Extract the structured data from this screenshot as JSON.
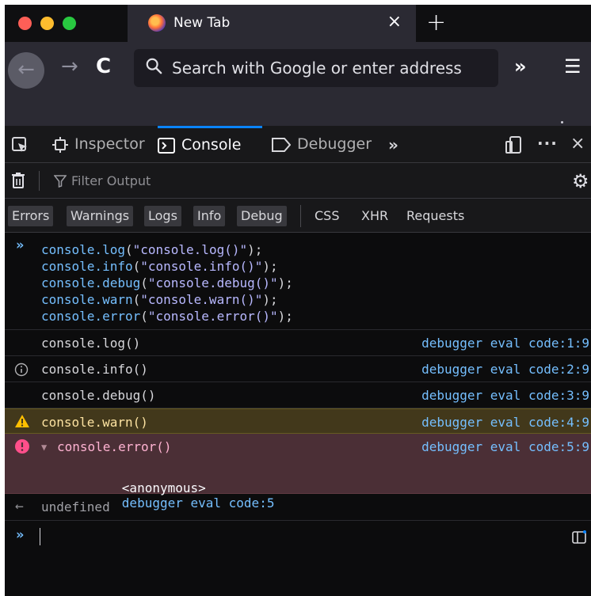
{
  "tab": {
    "title": "New Tab",
    "close_label": "×",
    "new_tab_label": "+"
  },
  "nav": {
    "back_label": "←",
    "forward_label": "→",
    "reload_label": "C",
    "url_placeholder": "Search with Google or enter address",
    "overflow_label": "»",
    "menu_label": "☰"
  },
  "devtools": {
    "tabs": [
      {
        "label": "Inspector"
      },
      {
        "label": "Console"
      },
      {
        "label": "Debugger"
      }
    ],
    "more_tabs_label": "»",
    "options_label": "···",
    "close_label": "×",
    "selected_tab": "Console"
  },
  "filter": {
    "placeholder": "Filter Output"
  },
  "categories": {
    "levels": [
      "Errors",
      "Warnings",
      "Logs",
      "Info",
      "Debug"
    ],
    "types": [
      "CSS",
      "XHR",
      "Requests"
    ]
  },
  "console": {
    "input_block": {
      "lines": [
        {
          "fn": "console.log",
          "arg": "\"console.log()\""
        },
        {
          "fn": "console.info",
          "arg": "\"console.info()\""
        },
        {
          "fn": "console.debug",
          "arg": "\"console.debug()\""
        },
        {
          "fn": "console.warn",
          "arg": "\"console.warn()\""
        },
        {
          "fn": "console.error",
          "arg": "\"console.error()\""
        }
      ]
    },
    "messages": [
      {
        "level": "log",
        "text": "console.log()",
        "source": "debugger eval code:1:9"
      },
      {
        "level": "info",
        "text": "console.info()",
        "source": "debugger eval code:2:9"
      },
      {
        "level": "debug",
        "text": "console.debug()",
        "source": "debugger eval code:3:9"
      },
      {
        "level": "warn",
        "text": "console.warn()",
        "source": "debugger eval code:4:9"
      },
      {
        "level": "error",
        "text": "console.error()",
        "source": "debugger eval code:5:9",
        "stack": {
          "fname": "<anonymous>",
          "loc": "debugger eval code:5"
        }
      }
    ],
    "result": "undefined"
  },
  "colors": {
    "accent": "#0a84ff",
    "link": "#75bfff",
    "warn_bg": "#42381b",
    "error_bg": "#4b2f36"
  }
}
